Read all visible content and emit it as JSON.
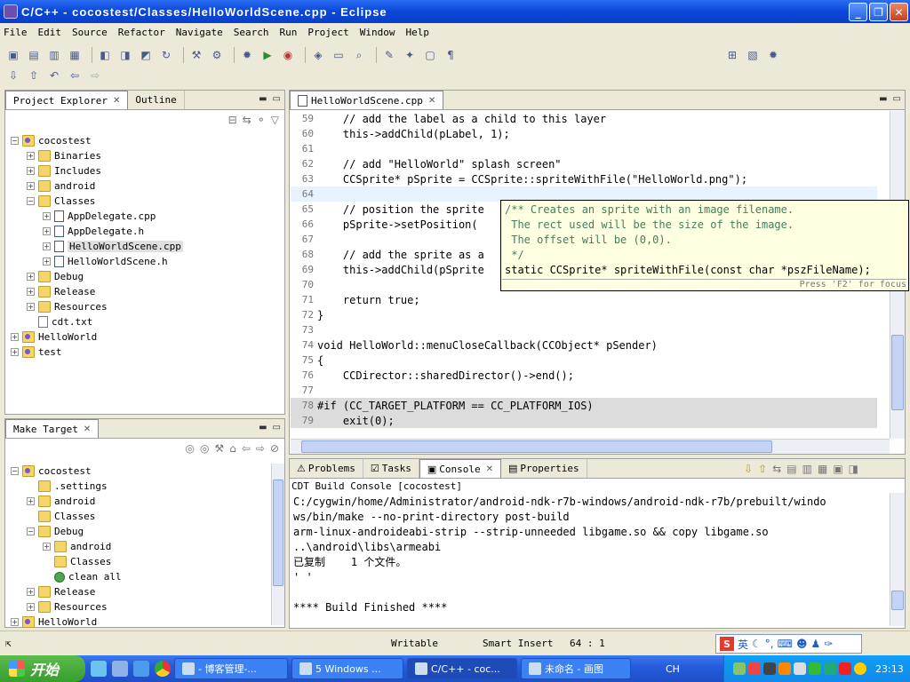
{
  "window": {
    "title": "C/C++ - cocostest/Classes/HelloWorldScene.cpp - Eclipse",
    "minimize_glyph": "_",
    "restore_glyph": "❐",
    "close_glyph": "✕"
  },
  "menu": [
    "File",
    "Edit",
    "Source",
    "Refactor",
    "Navigate",
    "Search",
    "Run",
    "Project",
    "Window",
    "Help"
  ],
  "project_explorer": {
    "tabs": [
      {
        "label": "Project Explorer",
        "close": "✕"
      },
      {
        "label": "Outline"
      }
    ],
    "tree": [
      {
        "label": "cocostest",
        "depth": 0,
        "exp": "−",
        "icon": "proj"
      },
      {
        "label": "Binaries",
        "depth": 1,
        "exp": "+",
        "icon": "folder"
      },
      {
        "label": "Includes",
        "depth": 1,
        "exp": "+",
        "icon": "folder"
      },
      {
        "label": "android",
        "depth": 1,
        "exp": "+",
        "icon": "folder"
      },
      {
        "label": "Classes",
        "depth": 1,
        "exp": "−",
        "icon": "folder"
      },
      {
        "label": "AppDelegate.cpp",
        "depth": 2,
        "exp": "+",
        "icon": "filec"
      },
      {
        "label": "AppDelegate.h",
        "depth": 2,
        "exp": "+",
        "icon": "filec"
      },
      {
        "label": "HelloWorldScene.cpp",
        "depth": 2,
        "exp": "+",
        "icon": "filec",
        "selected": true
      },
      {
        "label": "HelloWorldScene.h",
        "depth": 2,
        "exp": "+",
        "icon": "filec"
      },
      {
        "label": "Debug",
        "depth": 1,
        "exp": "+",
        "icon": "folder"
      },
      {
        "label": "Release",
        "depth": 1,
        "exp": "+",
        "icon": "folder"
      },
      {
        "label": "Resources",
        "depth": 1,
        "exp": "+",
        "icon": "folder"
      },
      {
        "label": "cdt.txt",
        "depth": 1,
        "exp": "",
        "icon": "file"
      },
      {
        "label": "HelloWorld",
        "depth": 0,
        "exp": "+",
        "icon": "proj"
      },
      {
        "label": "test",
        "depth": 0,
        "exp": "+",
        "icon": "proj"
      }
    ]
  },
  "make_target": {
    "tab": "Make Target",
    "tree": [
      {
        "label": "cocostest",
        "depth": 0,
        "exp": "−",
        "icon": "proj"
      },
      {
        "label": ".settings",
        "depth": 1,
        "exp": "",
        "icon": "folder"
      },
      {
        "label": "android",
        "depth": 1,
        "exp": "+",
        "icon": "folder"
      },
      {
        "label": "Classes",
        "depth": 1,
        "exp": "",
        "icon": "folder"
      },
      {
        "label": "Debug",
        "depth": 1,
        "exp": "−",
        "icon": "folder"
      },
      {
        "label": "android",
        "depth": 2,
        "exp": "+",
        "icon": "folder"
      },
      {
        "label": "Classes",
        "depth": 2,
        "exp": "",
        "icon": "folder"
      },
      {
        "label": "clean all",
        "depth": 2,
        "exp": "",
        "icon": "target"
      },
      {
        "label": "Release",
        "depth": 1,
        "exp": "+",
        "icon": "folder"
      },
      {
        "label": "Resources",
        "depth": 1,
        "exp": "+",
        "icon": "folder"
      },
      {
        "label": "HelloWorld",
        "depth": 0,
        "exp": "+",
        "icon": "proj"
      }
    ]
  },
  "editor": {
    "tab": "HelloWorldScene.cpp",
    "lines": [
      {
        "n": "59",
        "t": "    // add the label as a child to this layer",
        "kind": "comment"
      },
      {
        "n": "60",
        "t": "    this->addChild(pLabel, 1);",
        "kind": "code"
      },
      {
        "n": "61",
        "t": "",
        "kind": "code"
      },
      {
        "n": "62",
        "t": "    // add \"HelloWorld\" splash screen\"",
        "kind": "comment"
      },
      {
        "n": "63",
        "t": "    CCSprite* pSprite = CCSprite::spriteWithFile(\"HelloWorld.png\");",
        "kind": "code"
      },
      {
        "n": "64",
        "t": "",
        "kind": "current"
      },
      {
        "n": "65",
        "t": "    // position the sprite",
        "kind": "comment"
      },
      {
        "n": "66",
        "t": "    pSprite->setPosition(",
        "kind": "code"
      },
      {
        "n": "67",
        "t": "",
        "kind": "code"
      },
      {
        "n": "68",
        "t": "    // add the sprite as a",
        "kind": "comment"
      },
      {
        "n": "69",
        "t": "    this->addChild(pSprite",
        "kind": "code"
      },
      {
        "n": "70",
        "t": "",
        "kind": "code"
      },
      {
        "n": "71",
        "t": "    return true;",
        "kind": "code"
      },
      {
        "n": "72",
        "t": "}",
        "kind": "code"
      },
      {
        "n": "73",
        "t": "",
        "kind": "code"
      },
      {
        "n": "74",
        "t": "void HelloWorld::menuCloseCallback(CCObject* pSender)",
        "kind": "code"
      },
      {
        "n": "75",
        "t": "{",
        "kind": "code"
      },
      {
        "n": "76",
        "t": "    CCDirector::sharedDirector()->end();",
        "kind": "code"
      },
      {
        "n": "77",
        "t": "",
        "kind": "code"
      },
      {
        "n": "78",
        "t": "#if (CC_TARGET_PLATFORM == CC_PLATFORM_IOS)",
        "kind": "grey"
      },
      {
        "n": "79",
        "t": "    exit(0);",
        "kind": "grey"
      }
    ],
    "hover": {
      "lines": [
        "/** Creates an sprite with an image filename.",
        " The rect used will be the size of the image.",
        " The offset will be (0,0).",
        " */",
        "static CCSprite* spriteWithFile(const char *pszFileName);"
      ],
      "hint": "Press 'F2' for focus"
    }
  },
  "console": {
    "tabs": [
      "Problems",
      "Tasks",
      "Console",
      "Properties"
    ],
    "active_tab": "Console",
    "title": "CDT Build Console [cocostest]",
    "lines": [
      "C:/cygwin/home/Administrator/android-ndk-r7b-windows/android-ndk-r7b/prebuilt/windo",
      "ws/bin/make --no-print-directory post-build",
      "arm-linux-androideabi-strip --strip-unneeded libgame.so && copy libgame.so",
      "..\\android\\libs\\armeabi",
      "已复制    1 个文件。",
      "' '",
      "",
      "**** Build Finished ****"
    ]
  },
  "status": {
    "writable": "Writable",
    "insert": "Smart Insert",
    "position": "64 : 1"
  },
  "ime": {
    "badge": "S",
    "mode": "英"
  },
  "taskbar": {
    "start": "开始",
    "tasks": [
      {
        "label": "- 博客管理-...",
        "active": false
      },
      {
        "label": "5 Windows ...",
        "active": false
      },
      {
        "label": "C/C++ - coc...",
        "active": true
      },
      {
        "label": "未命名 - 画图",
        "active": false
      }
    ],
    "lang": "CH",
    "clock": "23:13"
  },
  "colors": {
    "titlebar": "#0a46d8",
    "chrome": "#ece9d8",
    "comment": "#3f7f5f",
    "keyword": "#7f0055",
    "string": "#2a00ff",
    "hover_bg": "#ffffe1"
  }
}
